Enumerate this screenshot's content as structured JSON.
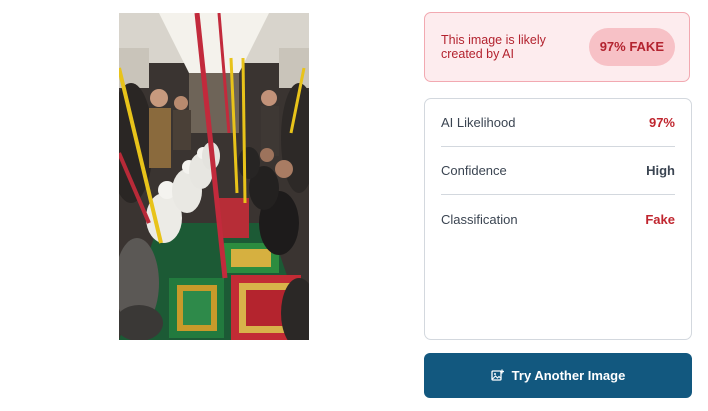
{
  "verdict": {
    "message": "This image is likely created by AI",
    "badge": "97% FAKE"
  },
  "details": {
    "rows": [
      {
        "label": "AI Likelihood",
        "value": "97%"
      },
      {
        "label": "Confidence",
        "value": "High"
      },
      {
        "label": "Classification",
        "value": "Fake"
      }
    ]
  },
  "actions": {
    "try_another_label": "Try Another Image",
    "try_another_icon": "image-upload-icon"
  },
  "colors": {
    "fake_red": "#c0262f",
    "verdict_bg": "#fdecee",
    "button_blue": "#12587f"
  }
}
